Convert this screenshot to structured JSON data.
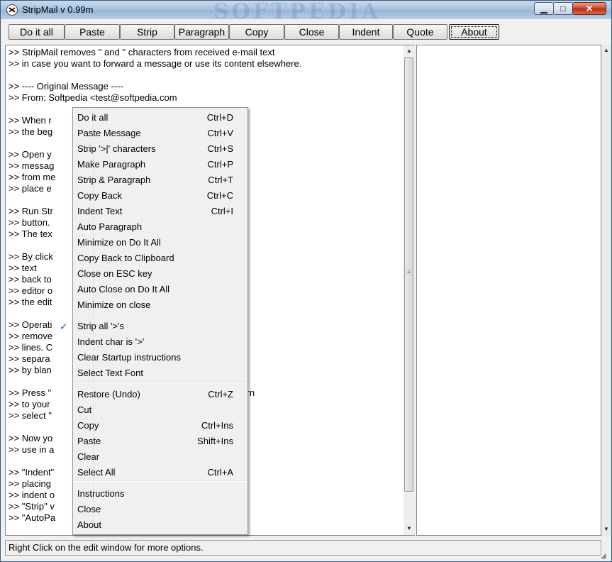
{
  "window": {
    "title": "StripMail v 0.99m",
    "watermark": "SOFTPEDIA"
  },
  "title_controls": {
    "minimize_icon": "minimize-icon",
    "maximize_icon": "maximize-icon",
    "close_icon": "close-icon",
    "minimize_glyph": "▁",
    "maximize_glyph": "□",
    "close_glyph": "✕"
  },
  "toolbar": {
    "buttons": [
      "Do it all",
      "Paste",
      "Strip",
      "Paragraph",
      "Copy",
      "Close",
      "Indent",
      "Quote",
      "About"
    ],
    "focused": "About"
  },
  "editor": {
    "lines": [
      ">> StripMail removes '' and '' characters from received e-mail text",
      ">> in case you want to forward a message or use its content elsewhere.",
      "",
      ">> ---- Original Message ----",
      ">> From: Softpedia <test@softpedia.com",
      "",
      ">> When r                                                     haracters at",
      ">> the beg",
      "",
      ">> Open y                                                     forward a",
      ">> messag                                                    Select All\" item",
      ">> from me                                                   em. This will",
      ">> place e",
      "",
      ">> Run Str                                                    \"Paste\"",
      ">> button.",
      ">> The tex                                                    nctions.",
      "",
      ">> By click                                                   and copy",
      ">> text",
      ">> back to                                                    g your mail",
      ">> editor o                                                   ext back to",
      ">> the edit",
      "",
      ">> Operati                                                    Strip\" button to",
      ">> remove                                                    ssage",
      ">> lines. C                                                   text",
      ">> separa",
      ">> by blan",
      "",
      ">> Press \"                                                    clipboard. Return",
      ">> to your                                                    sage text and",
      ">> select \"",
      "",
      ">> Now yo                                                     riend(s) or to",
      ">> use in a",
      "",
      ">> \"Indent\"                                                   lines,",
      ">> placing",
      ">> indent o                                                   ndenting,",
      ">> \"Strip\" v                                                  hat",
      ">> \"AutoPa"
    ]
  },
  "context_menu": {
    "items": [
      {
        "label": "Do it all",
        "shortcut": "Ctrl+D"
      },
      {
        "label": "Paste Message",
        "shortcut": "Ctrl+V"
      },
      {
        "label": "Strip '>|' characters",
        "shortcut": "Ctrl+S"
      },
      {
        "label": "Make Paragraph",
        "shortcut": "Ctrl+P"
      },
      {
        "label": "Strip & Paragraph",
        "shortcut": "Ctrl+T"
      },
      {
        "label": "Copy Back",
        "shortcut": "Ctrl+C"
      },
      {
        "label": "Indent Text",
        "shortcut": "Ctrl+I"
      },
      {
        "label": "Auto Paragraph",
        "shortcut": ""
      },
      {
        "label": "Minimize  on Do It All",
        "shortcut": ""
      },
      {
        "label": "Copy Back to Clipboard",
        "shortcut": ""
      },
      {
        "label": "Close on ESC key",
        "shortcut": ""
      },
      {
        "label": "Auto Close on Do It All",
        "shortcut": ""
      },
      {
        "label": "Minimize on close",
        "shortcut": ""
      },
      {
        "label": "Strip all '>'s",
        "shortcut": "",
        "checked": true,
        "check_glyph": "✓"
      },
      {
        "label": "Indent char  is '>'",
        "shortcut": ""
      },
      {
        "label": "Clear Startup instructions",
        "shortcut": ""
      },
      {
        "label": "Select Text Font",
        "shortcut": ""
      },
      {
        "label": "Restore (Undo)",
        "shortcut": "Ctrl+Z"
      },
      {
        "label": "Cut",
        "shortcut": ""
      },
      {
        "label": "Copy",
        "shortcut": "Ctrl+Ins"
      },
      {
        "label": "Paste",
        "shortcut": "Shift+Ins"
      },
      {
        "label": "Clear",
        "shortcut": ""
      },
      {
        "label": "Select All",
        "shortcut": "Ctrl+A"
      },
      {
        "label": "Instructions",
        "shortcut": ""
      },
      {
        "label": "Close",
        "shortcut": ""
      },
      {
        "label": "About",
        "shortcut": ""
      }
    ]
  },
  "status_bar": {
    "text": "Right Click on the edit window for more options."
  },
  "scrollbar": {
    "up_glyph": "▲",
    "down_glyph": "▼",
    "grip_glyph": "≡"
  },
  "colors": {
    "title_gradient": "#a9c3df",
    "close_button": "#c7432a",
    "check_mark": "#0b6bd6"
  }
}
